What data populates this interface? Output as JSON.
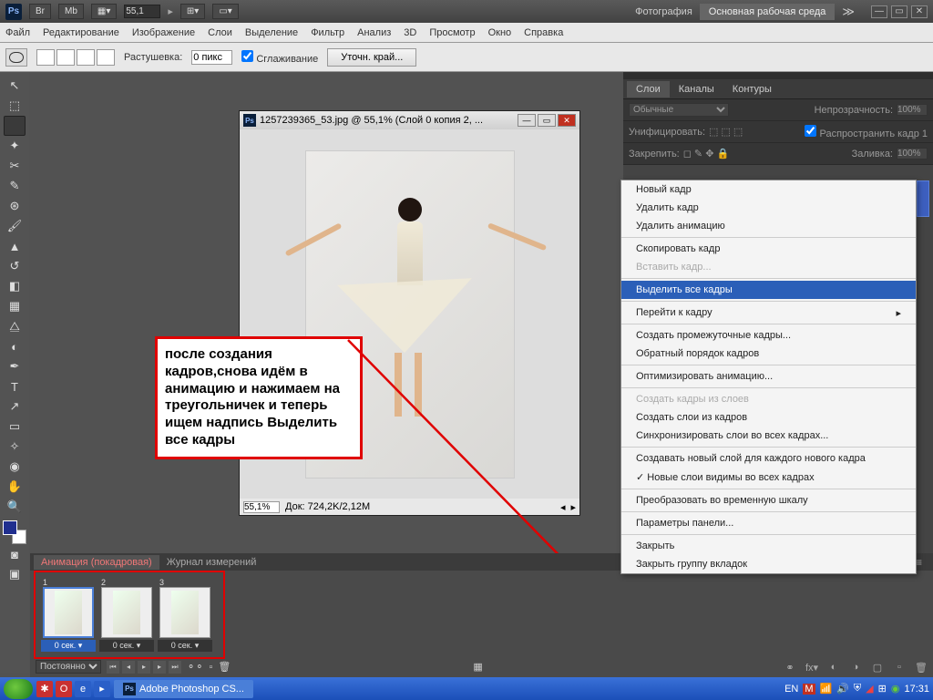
{
  "topbar": {
    "br": "Br",
    "mb": "Mb",
    "zoom": "55,1",
    "photo": "Фотография",
    "workspace": "Основная рабочая среда"
  },
  "menus": [
    "Файл",
    "Редактирование",
    "Изображение",
    "Слои",
    "Выделение",
    "Фильтр",
    "Анализ",
    "3D",
    "Просмотр",
    "Окно",
    "Справка"
  ],
  "optbar": {
    "feather_label": "Растушевка:",
    "feather_val": "0 пикс",
    "antialias": "Сглаживание",
    "refine": "Уточн. край..."
  },
  "doc": {
    "title": "1257239365_53.jpg @ 55,1% (Слой 0 копия 2, ...",
    "zoom": "55,1%",
    "status": "Док: 724,2K/2,12M"
  },
  "tutorial": "после создания кадров,снова идём в анимацию и нажимаем на треугольничек и теперь ищем надпись Выделить все кадры",
  "panel": {
    "tabs": [
      "Слои",
      "Каналы",
      "Контуры"
    ],
    "blend": "Обычные",
    "opacity_label": "Непрозрачность:",
    "opacity": "100%",
    "unify": "Унифицировать:",
    "propagate": "Распространить кадр 1",
    "lock": "Закрепить:",
    "fill_label": "Заливка:",
    "fill": "100%"
  },
  "menu_items": [
    {
      "t": "Новый кадр"
    },
    {
      "t": "Удалить кадр"
    },
    {
      "t": "Удалить анимацию"
    },
    {
      "sep": true
    },
    {
      "t": "Скопировать кадр"
    },
    {
      "t": "Вставить кадр...",
      "dis": true
    },
    {
      "sep": true
    },
    {
      "t": "Выделить все кадры",
      "hl": true
    },
    {
      "sep": true
    },
    {
      "t": "Перейти к кадру",
      "arr": true
    },
    {
      "sep": true
    },
    {
      "t": "Создать промежуточные кадры..."
    },
    {
      "t": "Обратный порядок кадров"
    },
    {
      "sep": true
    },
    {
      "t": "Оптимизировать анимацию..."
    },
    {
      "sep": true
    },
    {
      "t": "Создать кадры из слоев",
      "dis": true
    },
    {
      "t": "Создать слои из кадров"
    },
    {
      "t": "Синхронизировать слои во всех кадрах..."
    },
    {
      "sep": true
    },
    {
      "t": "Создавать новый слой для каждого нового кадра"
    },
    {
      "t": "Новые слои видимы во всех кадрах",
      "chk": true
    },
    {
      "sep": true
    },
    {
      "t": "Преобразовать во временную шкалу"
    },
    {
      "sep": true
    },
    {
      "t": "Параметры панели..."
    },
    {
      "sep": true
    },
    {
      "t": "Закрыть"
    },
    {
      "t": "Закрыть группу вкладок"
    }
  ],
  "anim": {
    "tabs": [
      "Анимация (покадровая)",
      "Журнал измерений"
    ],
    "frames": [
      {
        "n": "1",
        "d": "0 сек.",
        "sel": true
      },
      {
        "n": "2",
        "d": "0 сек."
      },
      {
        "n": "3",
        "d": "0 сек."
      }
    ],
    "loop": "Постоянно"
  },
  "taskbar": {
    "app": "Adobe Photoshop CS...",
    "lang": "EN",
    "time": "17:31"
  }
}
